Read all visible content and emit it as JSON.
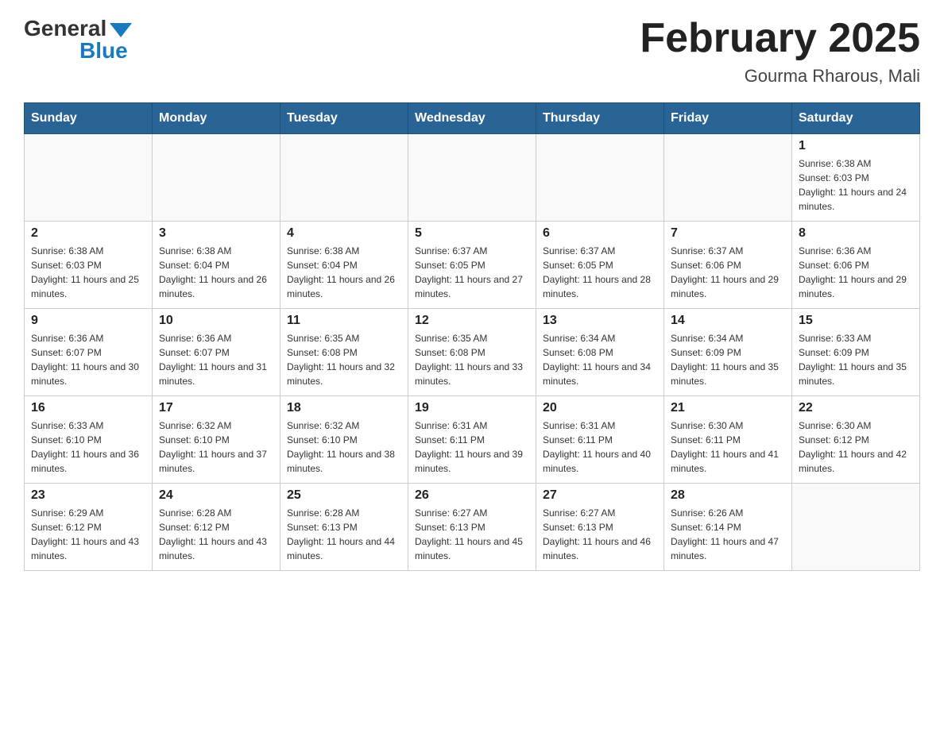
{
  "logo": {
    "general": "General",
    "blue": "Blue"
  },
  "title": "February 2025",
  "subtitle": "Gourma Rharous, Mali",
  "weekdays": [
    "Sunday",
    "Monday",
    "Tuesday",
    "Wednesday",
    "Thursday",
    "Friday",
    "Saturday"
  ],
  "weeks": [
    [
      {
        "day": "",
        "sunrise": "",
        "sunset": "",
        "daylight": ""
      },
      {
        "day": "",
        "sunrise": "",
        "sunset": "",
        "daylight": ""
      },
      {
        "day": "",
        "sunrise": "",
        "sunset": "",
        "daylight": ""
      },
      {
        "day": "",
        "sunrise": "",
        "sunset": "",
        "daylight": ""
      },
      {
        "day": "",
        "sunrise": "",
        "sunset": "",
        "daylight": ""
      },
      {
        "day": "",
        "sunrise": "",
        "sunset": "",
        "daylight": ""
      },
      {
        "day": "1",
        "sunrise": "Sunrise: 6:38 AM",
        "sunset": "Sunset: 6:03 PM",
        "daylight": "Daylight: 11 hours and 24 minutes."
      }
    ],
    [
      {
        "day": "2",
        "sunrise": "Sunrise: 6:38 AM",
        "sunset": "Sunset: 6:03 PM",
        "daylight": "Daylight: 11 hours and 25 minutes."
      },
      {
        "day": "3",
        "sunrise": "Sunrise: 6:38 AM",
        "sunset": "Sunset: 6:04 PM",
        "daylight": "Daylight: 11 hours and 26 minutes."
      },
      {
        "day": "4",
        "sunrise": "Sunrise: 6:38 AM",
        "sunset": "Sunset: 6:04 PM",
        "daylight": "Daylight: 11 hours and 26 minutes."
      },
      {
        "day": "5",
        "sunrise": "Sunrise: 6:37 AM",
        "sunset": "Sunset: 6:05 PM",
        "daylight": "Daylight: 11 hours and 27 minutes."
      },
      {
        "day": "6",
        "sunrise": "Sunrise: 6:37 AM",
        "sunset": "Sunset: 6:05 PM",
        "daylight": "Daylight: 11 hours and 28 minutes."
      },
      {
        "day": "7",
        "sunrise": "Sunrise: 6:37 AM",
        "sunset": "Sunset: 6:06 PM",
        "daylight": "Daylight: 11 hours and 29 minutes."
      },
      {
        "day": "8",
        "sunrise": "Sunrise: 6:36 AM",
        "sunset": "Sunset: 6:06 PM",
        "daylight": "Daylight: 11 hours and 29 minutes."
      }
    ],
    [
      {
        "day": "9",
        "sunrise": "Sunrise: 6:36 AM",
        "sunset": "Sunset: 6:07 PM",
        "daylight": "Daylight: 11 hours and 30 minutes."
      },
      {
        "day": "10",
        "sunrise": "Sunrise: 6:36 AM",
        "sunset": "Sunset: 6:07 PM",
        "daylight": "Daylight: 11 hours and 31 minutes."
      },
      {
        "day": "11",
        "sunrise": "Sunrise: 6:35 AM",
        "sunset": "Sunset: 6:08 PM",
        "daylight": "Daylight: 11 hours and 32 minutes."
      },
      {
        "day": "12",
        "sunrise": "Sunrise: 6:35 AM",
        "sunset": "Sunset: 6:08 PM",
        "daylight": "Daylight: 11 hours and 33 minutes."
      },
      {
        "day": "13",
        "sunrise": "Sunrise: 6:34 AM",
        "sunset": "Sunset: 6:08 PM",
        "daylight": "Daylight: 11 hours and 34 minutes."
      },
      {
        "day": "14",
        "sunrise": "Sunrise: 6:34 AM",
        "sunset": "Sunset: 6:09 PM",
        "daylight": "Daylight: 11 hours and 35 minutes."
      },
      {
        "day": "15",
        "sunrise": "Sunrise: 6:33 AM",
        "sunset": "Sunset: 6:09 PM",
        "daylight": "Daylight: 11 hours and 35 minutes."
      }
    ],
    [
      {
        "day": "16",
        "sunrise": "Sunrise: 6:33 AM",
        "sunset": "Sunset: 6:10 PM",
        "daylight": "Daylight: 11 hours and 36 minutes."
      },
      {
        "day": "17",
        "sunrise": "Sunrise: 6:32 AM",
        "sunset": "Sunset: 6:10 PM",
        "daylight": "Daylight: 11 hours and 37 minutes."
      },
      {
        "day": "18",
        "sunrise": "Sunrise: 6:32 AM",
        "sunset": "Sunset: 6:10 PM",
        "daylight": "Daylight: 11 hours and 38 minutes."
      },
      {
        "day": "19",
        "sunrise": "Sunrise: 6:31 AM",
        "sunset": "Sunset: 6:11 PM",
        "daylight": "Daylight: 11 hours and 39 minutes."
      },
      {
        "day": "20",
        "sunrise": "Sunrise: 6:31 AM",
        "sunset": "Sunset: 6:11 PM",
        "daylight": "Daylight: 11 hours and 40 minutes."
      },
      {
        "day": "21",
        "sunrise": "Sunrise: 6:30 AM",
        "sunset": "Sunset: 6:11 PM",
        "daylight": "Daylight: 11 hours and 41 minutes."
      },
      {
        "day": "22",
        "sunrise": "Sunrise: 6:30 AM",
        "sunset": "Sunset: 6:12 PM",
        "daylight": "Daylight: 11 hours and 42 minutes."
      }
    ],
    [
      {
        "day": "23",
        "sunrise": "Sunrise: 6:29 AM",
        "sunset": "Sunset: 6:12 PM",
        "daylight": "Daylight: 11 hours and 43 minutes."
      },
      {
        "day": "24",
        "sunrise": "Sunrise: 6:28 AM",
        "sunset": "Sunset: 6:12 PM",
        "daylight": "Daylight: 11 hours and 43 minutes."
      },
      {
        "day": "25",
        "sunrise": "Sunrise: 6:28 AM",
        "sunset": "Sunset: 6:13 PM",
        "daylight": "Daylight: 11 hours and 44 minutes."
      },
      {
        "day": "26",
        "sunrise": "Sunrise: 6:27 AM",
        "sunset": "Sunset: 6:13 PM",
        "daylight": "Daylight: 11 hours and 45 minutes."
      },
      {
        "day": "27",
        "sunrise": "Sunrise: 6:27 AM",
        "sunset": "Sunset: 6:13 PM",
        "daylight": "Daylight: 11 hours and 46 minutes."
      },
      {
        "day": "28",
        "sunrise": "Sunrise: 6:26 AM",
        "sunset": "Sunset: 6:14 PM",
        "daylight": "Daylight: 11 hours and 47 minutes."
      },
      {
        "day": "",
        "sunrise": "",
        "sunset": "",
        "daylight": ""
      }
    ]
  ]
}
